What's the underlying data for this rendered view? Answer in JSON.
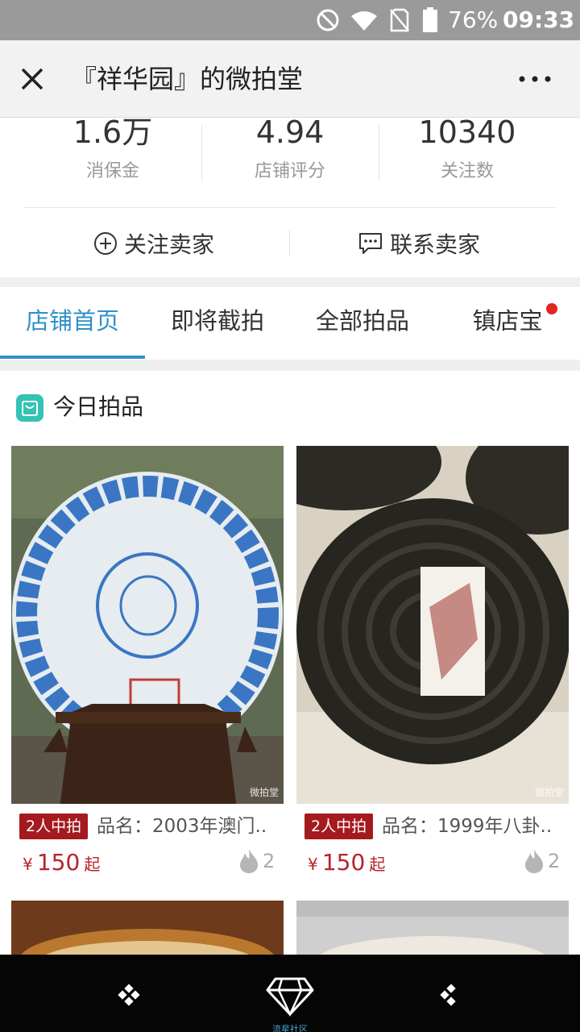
{
  "status_bar": {
    "battery": "76%",
    "time": "09:33",
    "icons": [
      "dnd-icon",
      "wifi-icon",
      "no-sim-icon",
      "battery-icon"
    ]
  },
  "header": {
    "title": "『祥华园』的微拍堂",
    "close_icon": "close-icon",
    "more_icon": "more-icon"
  },
  "stats": [
    {
      "value": "1.6万",
      "label": "消保金"
    },
    {
      "value": "4.94",
      "label": "店铺评分"
    },
    {
      "value": "10340",
      "label": "关注数"
    }
  ],
  "actions": {
    "follow": "关注卖家",
    "contact": "联系卖家"
  },
  "tabs": [
    {
      "label": "店铺首页",
      "active": true
    },
    {
      "label": "即将截拍",
      "active": false
    },
    {
      "label": "全部拍品",
      "active": false
    },
    {
      "label": "镇店宝",
      "active": false,
      "dot": true
    }
  ],
  "section": {
    "title": "今日拍品"
  },
  "products": [
    {
      "badge": "2人中拍",
      "name": "品名：2003年澳门..",
      "currency": "¥",
      "price": "150",
      "suffix": "起",
      "hot": "2",
      "watermark": "微拍堂"
    },
    {
      "badge": "2人中拍",
      "name": "品名：1999年八卦..",
      "currency": "¥",
      "price": "150",
      "suffix": "起",
      "hot": "2",
      "watermark": "微拍堂"
    }
  ],
  "bottom_nav": {
    "center_label": "流星社区"
  },
  "colors": {
    "accent": "#2f91c9",
    "badge": "#a51a1f",
    "price": "#b8232a",
    "status_bar": "#9a9a9a"
  }
}
